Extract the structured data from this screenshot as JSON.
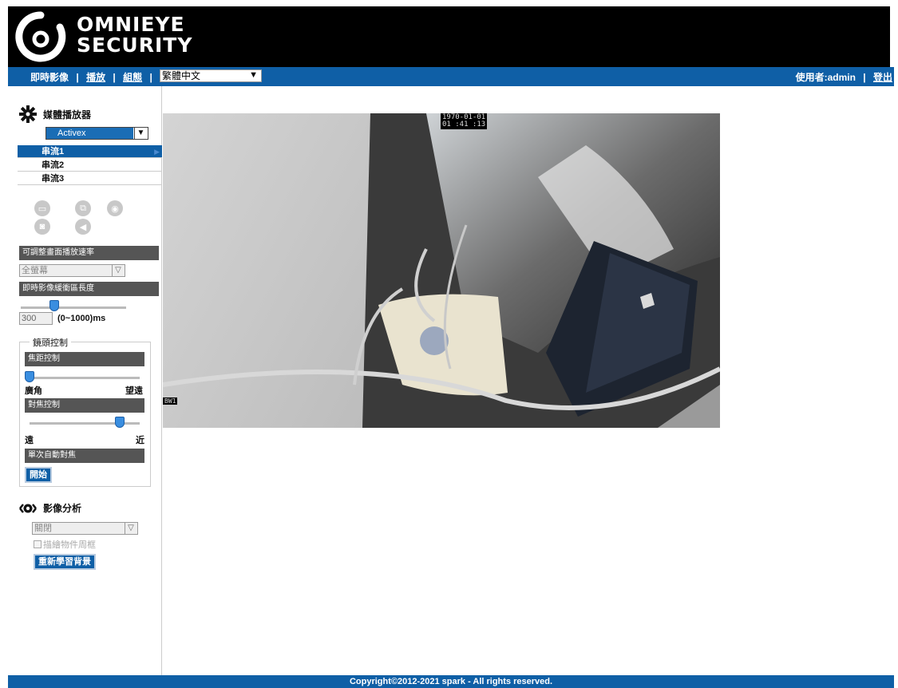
{
  "brand": {
    "line1": "OMNIEYE",
    "line2": "SECURITY"
  },
  "nav": {
    "live": "即時影像",
    "sep": "|",
    "playback": "播放",
    "config": "組態",
    "language": "繁體中文",
    "user_label": "使用者:admin",
    "logout": "登出"
  },
  "sidebar": {
    "media_player": {
      "title": "媒體播放器",
      "selected": "Activex"
    },
    "streams": [
      "串流1",
      "串流2",
      "串流3"
    ],
    "active_stream": 0,
    "playback_rate_label": "可調整畫面播放速率",
    "playback_rate_value": "全螢幕",
    "buffer_label": "即時影像緩衝區長度",
    "buffer_value": "300",
    "buffer_unit": "(0~1000)ms",
    "buffer_level": 0.3,
    "lens": {
      "title": "鏡頭控制",
      "zoom_label": "焦距控制",
      "zoom_min": "廣角",
      "zoom_max": "望遠",
      "zoom_level": 0.0,
      "focus_label": "對焦控制",
      "focus_min": "遠",
      "focus_max": "近",
      "focus_level": 0.85,
      "autofocus_label": "單次自動對焦",
      "start_button": "開始"
    },
    "analysis": {
      "title": "影像分析",
      "mode": "關閉",
      "draw_bbox": "描繪物件周框",
      "relearn_button": "重新學習背景"
    }
  },
  "video": {
    "osd_date": "1970-01-01",
    "osd_time": "01 :41 :13",
    "osd_cam": "BW1"
  },
  "footer": {
    "copyright": "Copyright©2012-2021 spark - All rights reserved."
  },
  "colors": {
    "nav_blue": "#0f5fa6",
    "header_black": "#000000",
    "label_gray": "#555555"
  }
}
